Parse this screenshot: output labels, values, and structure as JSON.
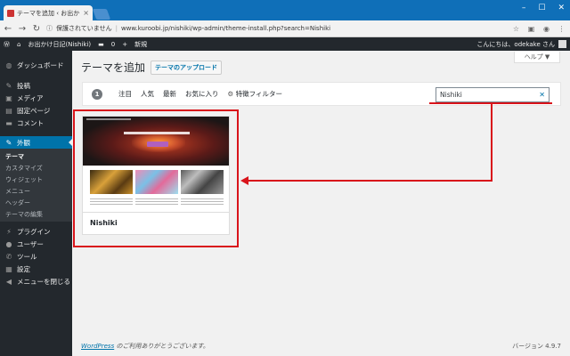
{
  "browser": {
    "tab_title": "テーマを追加 ‹ お出かけ日記",
    "tab_close": "×",
    "window_min": "–",
    "window_max": "☐",
    "window_close": "✕",
    "security_text": "保護されていません",
    "url": "www.kuroobi.jp/nishiki/wp-admin/theme-install.php?search=Nishiki"
  },
  "adminbar": {
    "site_name": "お出かけ日記(Nishiki)",
    "comments_count": "0",
    "new_label": "新規",
    "greeting": "こんにちは、odekake さん"
  },
  "sidebar": {
    "items": [
      {
        "icon": "dashboard-icon",
        "glyph": "◍",
        "label": "ダッシュボード"
      },
      {
        "icon": "pin-icon",
        "glyph": "✎",
        "label": "投稿"
      },
      {
        "icon": "media-icon",
        "glyph": "▣",
        "label": "メディア"
      },
      {
        "icon": "page-icon",
        "glyph": "▤",
        "label": "固定ページ"
      },
      {
        "icon": "comment-icon",
        "glyph": "▬",
        "label": "コメント"
      },
      {
        "icon": "appearance-icon",
        "glyph": "✎",
        "label": "外観"
      },
      {
        "icon": "plugin-icon",
        "glyph": "⚡",
        "label": "プラグイン"
      },
      {
        "icon": "user-icon",
        "glyph": "●",
        "label": "ユーザー"
      },
      {
        "icon": "tool-icon",
        "glyph": "✆",
        "label": "ツール"
      },
      {
        "icon": "settings-icon",
        "glyph": "▦",
        "label": "設定"
      },
      {
        "icon": "collapse-icon",
        "glyph": "◀",
        "label": "メニューを閉じる"
      }
    ],
    "submenu": [
      "テーマ",
      "カスタマイズ",
      "ウィジェット",
      "メニュー",
      "ヘッダー",
      "テーマの編集"
    ]
  },
  "main": {
    "help_label": "ヘルプ ▼",
    "page_title": "テーマを追加",
    "upload_label": "テーマのアップロード",
    "result_count": "1",
    "filters": [
      "注目",
      "人気",
      "最新",
      "お気に入り"
    ],
    "feature_filter": "特徴フィルター",
    "search_value": "Nishiki",
    "theme_name": "Nishiki"
  },
  "footer": {
    "wordpress_link": "WordPress",
    "thanks": " のご利用ありがとうございます。",
    "version": "バージョン 4.9.7"
  },
  "colors": {
    "accent": "#0073aa",
    "annotation": "#d9141b",
    "sidebar_bg": "#23282d"
  }
}
